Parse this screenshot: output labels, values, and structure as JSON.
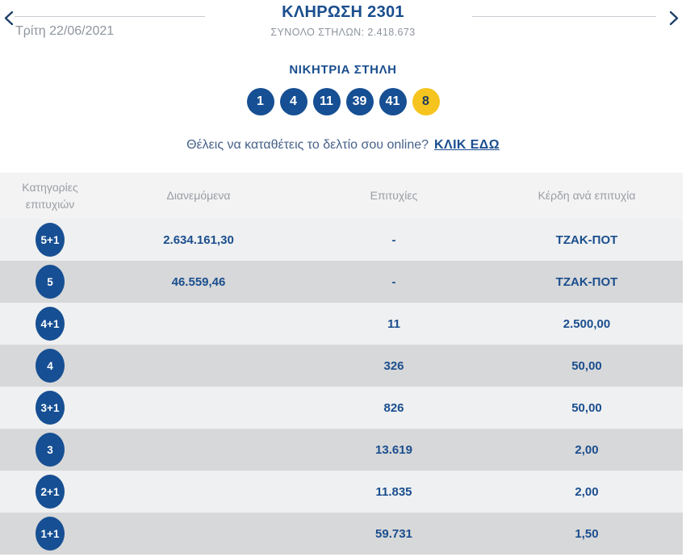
{
  "header": {
    "title": "ΚΛΗΡΩΣΗ 2301",
    "subtitle": "ΣΥΝΟΛΟ ΣΤΗΛΩΝ: 2.418.673",
    "date": "Τρίτη 22/06/2021"
  },
  "winning": {
    "label": "ΝΙΚΗΤΡΙΑ ΣΤΗΛΗ",
    "numbers": [
      "1",
      "4",
      "11",
      "39",
      "41"
    ],
    "joker": "8"
  },
  "cta": {
    "text": "Θέλεις να καταθέτεις το δελτίο σου online?",
    "link_label": "ΚΛΙΚ ΕΔΩ"
  },
  "table": {
    "headers": {
      "category": "Κατηγορίες επιτυχιών",
      "distributed": "Διανεμόμενα",
      "wins": "Επιτυχίες",
      "prize": "Κέρδη ανά επιτυχία"
    },
    "rows": [
      {
        "category": "5+1",
        "distributed": "2.634.161,30",
        "wins": "-",
        "prize": "ΤΖΑΚ-ΠΟΤ"
      },
      {
        "category": "5",
        "distributed": "46.559,46",
        "wins": "-",
        "prize": "ΤΖΑΚ-ΠΟΤ"
      },
      {
        "category": "4+1",
        "distributed": "",
        "wins": "11",
        "prize": "2.500,00"
      },
      {
        "category": "4",
        "distributed": "",
        "wins": "326",
        "prize": "50,00"
      },
      {
        "category": "3+1",
        "distributed": "",
        "wins": "826",
        "prize": "50,00"
      },
      {
        "category": "3",
        "distributed": "",
        "wins": "13.619",
        "prize": "2,00"
      },
      {
        "category": "2+1",
        "distributed": "",
        "wins": "11.835",
        "prize": "2,00"
      },
      {
        "category": "1+1",
        "distributed": "",
        "wins": "59.731",
        "prize": "1,50"
      }
    ]
  },
  "colors": {
    "navy": "#1a4e8e",
    "ball-blue": "#164f93",
    "joker-yellow": "#f6c41f",
    "joker-text": "#1c3a5f",
    "gray-text": "#8e949d",
    "row-light": "#eff0f1",
    "row-dark": "#d7d8d9",
    "header-bg": "#f3f3f4"
  }
}
